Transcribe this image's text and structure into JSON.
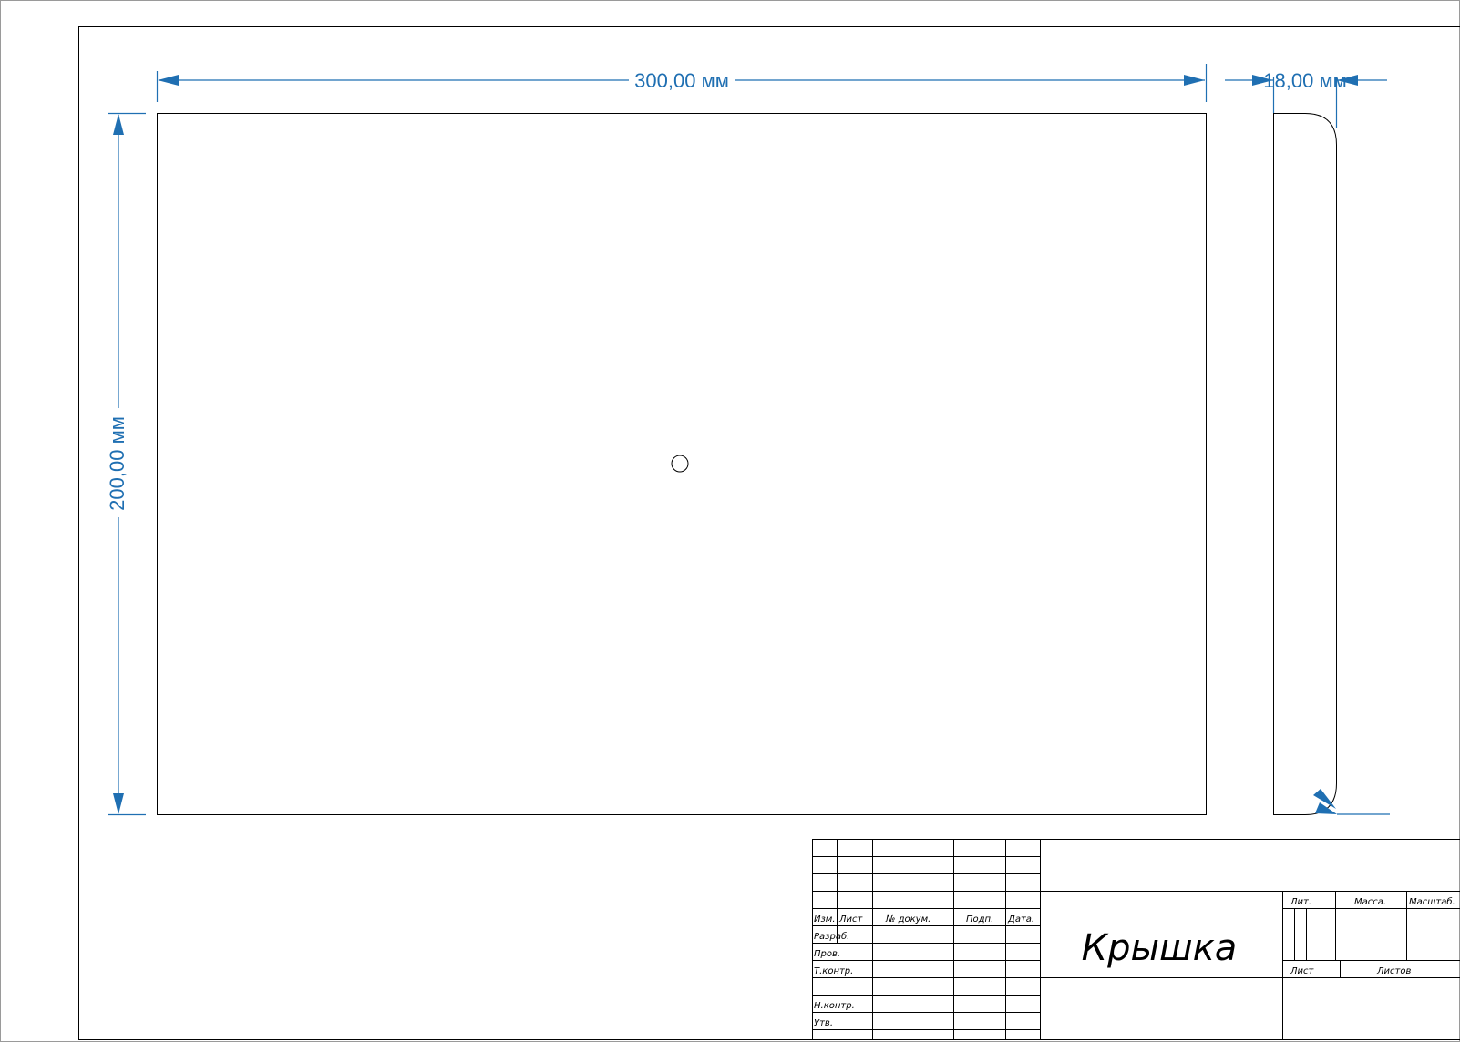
{
  "dimensions": {
    "width": "300,00 мм",
    "height": "200,00 мм",
    "thickness": "18,00 мм"
  },
  "title_block": {
    "title": "Крышка",
    "headers": {
      "izm": "Изм.",
      "list": "Лист",
      "doc": "№ докум.",
      "sign": "Подп.",
      "date": "Дата."
    },
    "rows": {
      "razrab": "Разраб.",
      "prov": "Пров.",
      "tkontr": "Т.контр.",
      "nkontr": "Н.контр.",
      "utv": "Утв."
    },
    "right": {
      "lit": "Лит.",
      "massa": "Масса.",
      "masshtab": "Масштаб.",
      "list": "Лист",
      "listov": "Листов"
    }
  },
  "colors": {
    "dimension": "#1f6fb2",
    "outline": "#000000"
  }
}
